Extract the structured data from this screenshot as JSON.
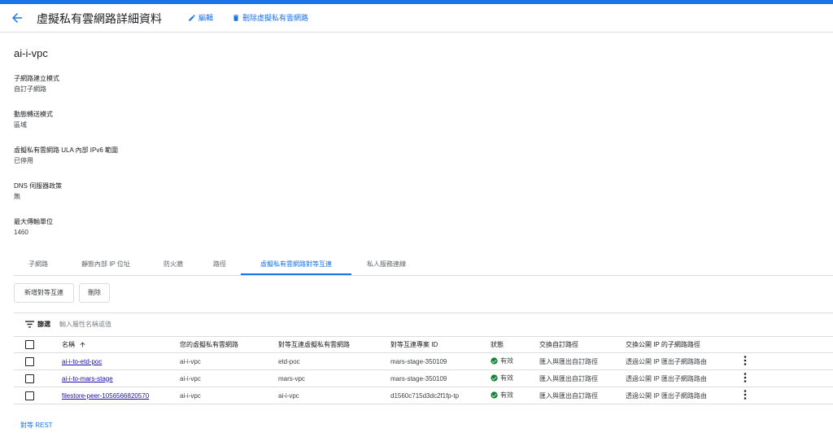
{
  "header": {
    "title": "虛擬私有雲網路詳細資料",
    "edit_label": "編輯",
    "delete_label": "刪除虛擬私有雲網路"
  },
  "vpc_name": "ai-i-vpc",
  "fields": [
    {
      "label": "子網路建立模式",
      "value": "自訂子網路"
    },
    {
      "label": "動態轉送模式",
      "value": "區域"
    },
    {
      "label": "虛擬私有雲網路 ULA 內部 IPv6 範圍",
      "value": "已停用"
    },
    {
      "label": "DNS 伺服器政策",
      "value": "無"
    },
    {
      "label": "最大傳輸單位",
      "value": "1460"
    }
  ],
  "tabs": [
    "子網路",
    "靜態內部 IP 位址",
    "防火牆",
    "路徑",
    "虛擬私有雲網路對等互連",
    "私人服務連線"
  ],
  "active_tab_index": 4,
  "actions": {
    "add_peering": "新增對等互連",
    "delete": "刪除"
  },
  "filter": {
    "label": "篩選",
    "placeholder": "輸入屬性名稱或值"
  },
  "table": {
    "columns": [
      "名稱",
      "您的虛擬私有雲網路",
      "對等互連虛擬私有雲網路",
      "對等互連專案 ID",
      "狀態",
      "交換自訂路徑",
      "交換公開 IP 的子網路路徑"
    ],
    "rows": [
      {
        "name": "ai-i-to-etd-poc",
        "your_vpc": "ai-i-vpc",
        "peer_vpc": "etd-poc",
        "project_id": "mars-stage-350109",
        "status": "有效",
        "custom_routes": "匯入與匯出自訂路徑",
        "public_ip_routes": "透過公開 IP 匯出子網路路由"
      },
      {
        "name": "ai-i-to-mars-stage",
        "your_vpc": "ai-i-vpc",
        "peer_vpc": "mars-vpc",
        "project_id": "mars-stage-350109",
        "status": "有效",
        "custom_routes": "匯入與匯出自訂路徑",
        "public_ip_routes": "透過公開 IP 匯出子網路路由"
      },
      {
        "name": "filestore-peer-1056566820570",
        "your_vpc": "ai-i-vpc",
        "peer_vpc": "ai-i-vpc",
        "project_id": "d1560c715d3dc2f1fp-tp",
        "status": "有效",
        "custom_routes": "匯入與匯出自訂路徑",
        "public_ip_routes": "透過公開 IP 匯出子網路路由"
      }
    ]
  },
  "rest_link": "對等 REST",
  "colors": {
    "accent": "#1a73e8",
    "status_ok": "#188038"
  }
}
